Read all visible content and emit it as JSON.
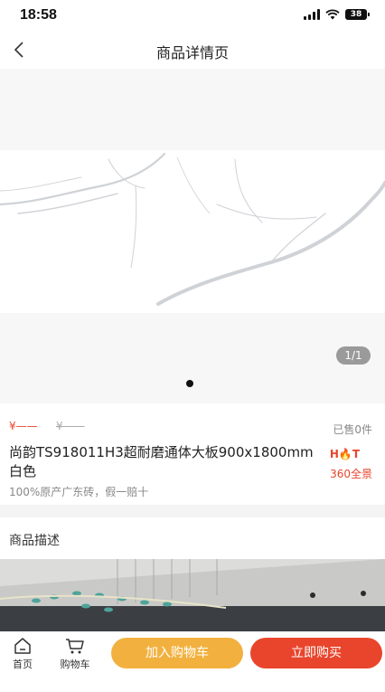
{
  "status_bar": {
    "time": "18:58",
    "battery": "38"
  },
  "nav": {
    "title": "商品详情页"
  },
  "gallery": {
    "page_indicator": "1/1"
  },
  "product": {
    "price": "¥——",
    "original_price": "¥——",
    "sold": "已售0件",
    "title": "尚韵TS918011H3超耐磨通体大板900x1800mm白色",
    "subtitle": "100%原产广东砖，假一赔十",
    "hot_badge": "H🔥T",
    "vr_label": "360全景"
  },
  "description": {
    "label": "商品描述"
  },
  "bottom_bar": {
    "home_label": "首页",
    "cart_label": "购物车",
    "add_cart_button": "加入购物车",
    "buy_button": "立即购买"
  },
  "colors": {
    "accent_red": "#e8452c",
    "accent_orange": "#f2b13f"
  }
}
